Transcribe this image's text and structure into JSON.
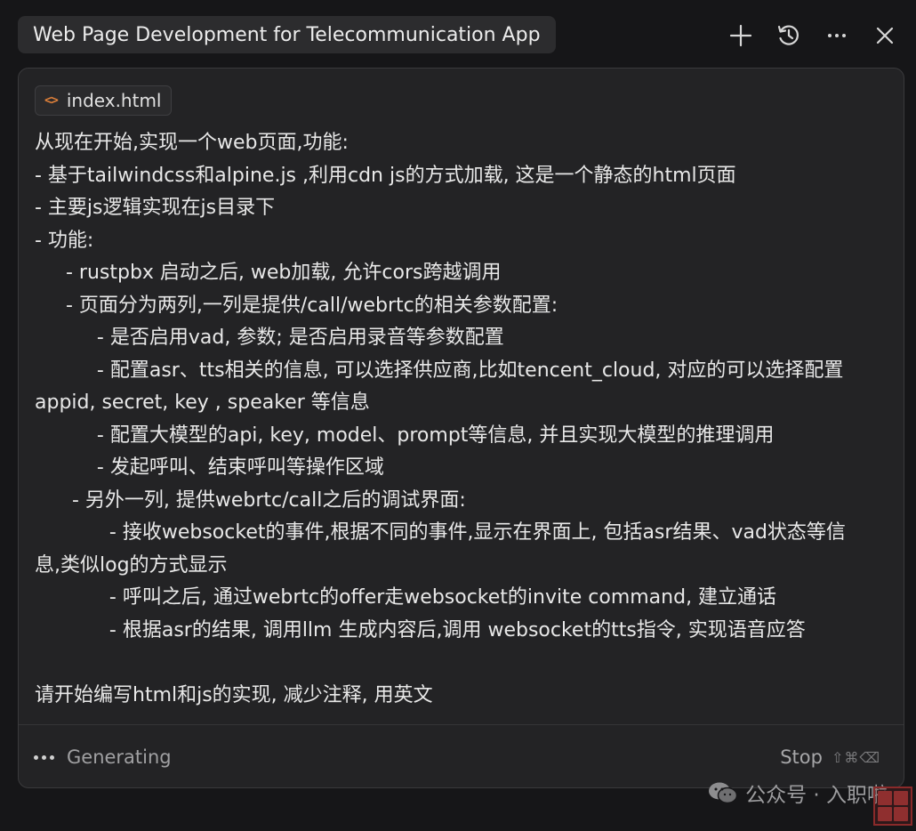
{
  "header": {
    "title": "Web Page Development for Telecommunication App",
    "icons": [
      "plus-icon",
      "history-icon",
      "more-icon",
      "close-icon"
    ]
  },
  "context": {
    "file_chip": "index.html",
    "file_icon": "code-icon"
  },
  "prompt": {
    "lines": [
      "从现在开始,实现一个web页面,功能:",
      "- 基于tailwindcss和alpine.js ,利用cdn js的方式加载, 这是一个静态的html页面",
      "- 主要js逻辑实现在js目录下",
      "- 功能:",
      "     - rustpbx 启动之后, web加载, 允许cors跨越调用",
      "     - 页面分为两列,一列是提供/call/webrtc的相关参数配置:",
      "          - 是否启用vad, 参数; 是否启用录音等参数配置",
      "          - 配置asr、tts相关的信息, 可以选择供应商,比如tencent_cloud, 对应的可以选择配置",
      "appid, secret, key , speaker 等信息",
      "          - 配置大模型的api, key, model、prompt等信息, 并且实现大模型的推理调用",
      "          - 发起呼叫、结束呼叫等操作区域",
      "      - 另外一列, 提供webrtc/call之后的调试界面:",
      "            - 接收websocket的事件,根据不同的事件,显示在界面上, 包括asr结果、vad状态等信",
      "息,类似log的方式显示",
      "            - 呼叫之后, 通过webrtc的offer走websocket的invite command, 建立通话",
      "            - 根据asr的结果, 调用llm 生成内容后,调用 websocket的tts指令, 实现语音应答",
      "",
      "请开始编写html和js的实现, 减少注释, 用英文"
    ]
  },
  "footer": {
    "status": "Generating",
    "stop_label": "Stop",
    "stop_shortcut": "⇧⌘⌫"
  },
  "watermark": {
    "text": "公众号 · 入职啦"
  },
  "colors": {
    "background": "#161618",
    "panel": "#232325",
    "accent_icon": "#e0813a"
  }
}
